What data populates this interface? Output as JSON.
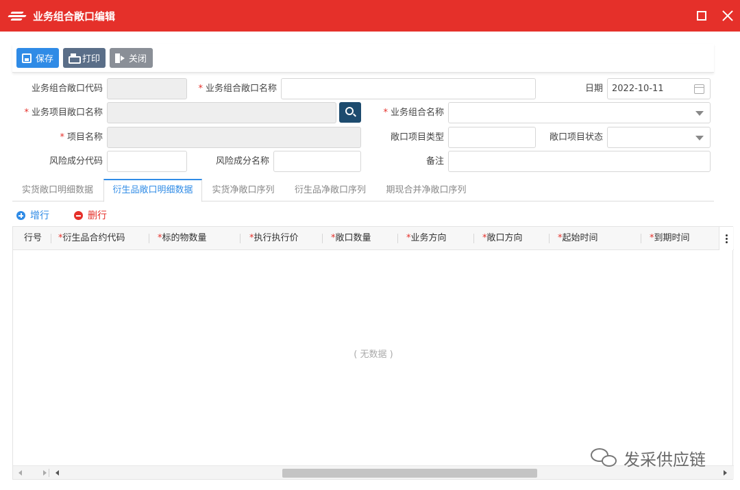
{
  "window": {
    "title": "业务组合敞口编辑"
  },
  "toolbar": {
    "save_label": "保存",
    "print_label": "打印",
    "close_label": "关闭"
  },
  "form": {
    "portfolio_code_label": "业务组合敞口代码",
    "portfolio_code_value": "",
    "portfolio_name_label": "业务组合敞口名称",
    "portfolio_name_value": "",
    "date_label": "日期",
    "date_value": "2022-10-11",
    "project_exposure_name_label": "业务项目敞口名称",
    "project_exposure_name_value": "",
    "business_group_name_label": "业务组合名称",
    "business_group_name_value": "",
    "project_name_label": "项目名称",
    "project_name_value": "",
    "exposure_project_type_label": "敞口项目类型",
    "exposure_project_type_value": "",
    "exposure_project_status_label": "敞口项目状态",
    "exposure_project_status_value": "",
    "risk_component_code_label": "风险成分代码",
    "risk_component_code_value": "",
    "risk_component_name_label": "风险成分名称",
    "risk_component_name_value": "",
    "remark_label": "备注",
    "remark_value": "",
    "required_mark": "*"
  },
  "tabs": [
    {
      "label": "实货敞口明细数据",
      "active": false
    },
    {
      "label": "衍生品敞口明细数据",
      "active": true
    },
    {
      "label": "实货净敞口序列",
      "active": false
    },
    {
      "label": "衍生品净敞口序列",
      "active": false
    },
    {
      "label": "期现合并净敞口序列",
      "active": false
    }
  ],
  "grid": {
    "add_label": "增行",
    "delete_label": "删行",
    "required_mark": "*",
    "columns": [
      {
        "label": "行号",
        "required": false
      },
      {
        "label": "衍生品合约代码",
        "required": true
      },
      {
        "label": "标的物数量",
        "required": true
      },
      {
        "label": "执行执行价",
        "required": true
      },
      {
        "label": "敞口数量",
        "required": true
      },
      {
        "label": "业务方向",
        "required": true
      },
      {
        "label": "敞口方向",
        "required": true
      },
      {
        "label": "起始时间",
        "required": true
      },
      {
        "label": "到期时间",
        "required": true
      }
    ],
    "rows": [],
    "empty_text": "( 无数据 )"
  },
  "watermark": {
    "text": "发采供应链"
  },
  "colors": {
    "titlebar": "#e5302a",
    "primary": "#2f8be6",
    "danger": "#e5302a",
    "search_button": "#1d4b6e"
  }
}
